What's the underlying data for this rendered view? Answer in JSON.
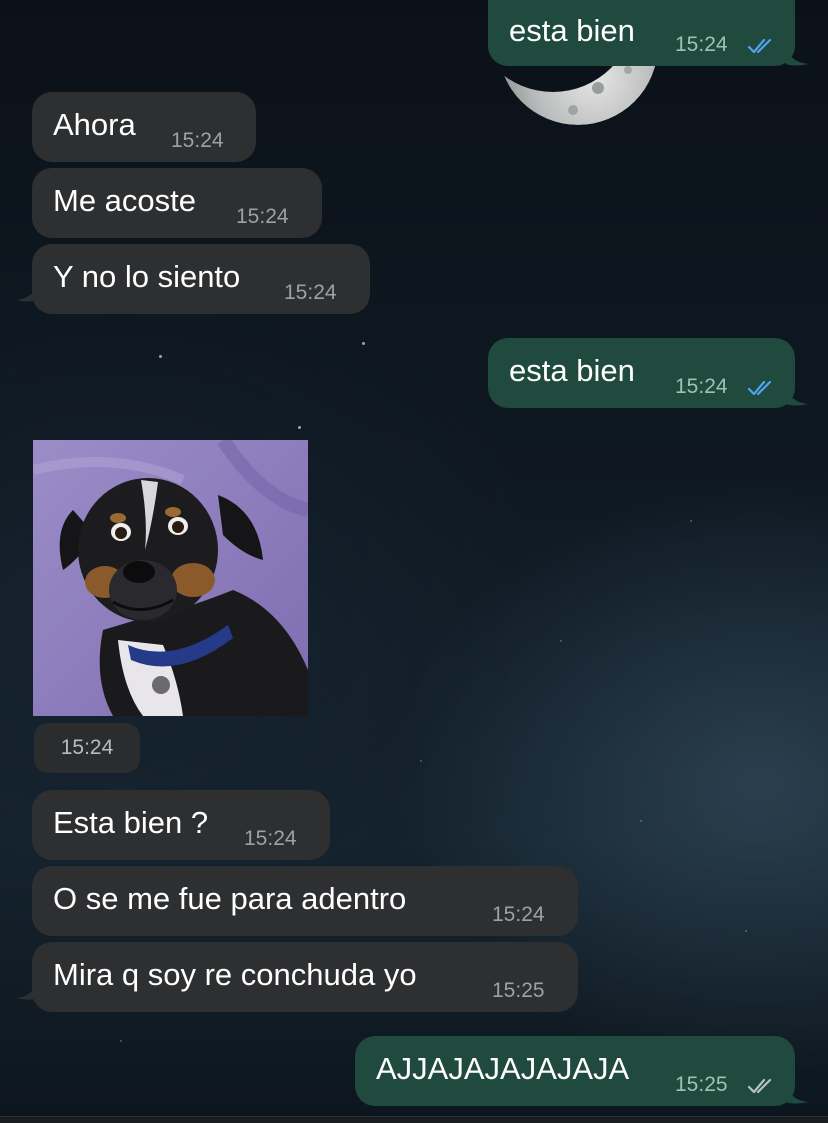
{
  "messages": [
    {
      "id": "m1",
      "direction": "out",
      "text": "esta bien",
      "time": "15:24",
      "status": "read"
    },
    {
      "id": "m2",
      "direction": "in",
      "text": "Ahora",
      "time": "15:24"
    },
    {
      "id": "m3",
      "direction": "in",
      "text": "Me acoste",
      "time": "15:24"
    },
    {
      "id": "m4",
      "direction": "in",
      "text": "Y no lo siento",
      "time": "15:24"
    },
    {
      "id": "m5",
      "direction": "out",
      "text": "esta bien",
      "time": "15:24",
      "status": "read"
    },
    {
      "id": "m6",
      "direction": "in",
      "type": "sticker",
      "subject": "dog-photo",
      "time": "15:24"
    },
    {
      "id": "m7",
      "direction": "in",
      "text": "Esta bien ?",
      "time": "15:24"
    },
    {
      "id": "m8",
      "direction": "in",
      "text": "O se me fue para adentro",
      "time": "15:24"
    },
    {
      "id": "m9",
      "direction": "in",
      "text": "Mira q soy re conchuda yo",
      "time": "15:25"
    },
    {
      "id": "m10",
      "direction": "out",
      "text": "AJJAJAJAJAJAJA",
      "time": "15:25",
      "status": "delivered"
    }
  ],
  "colors": {
    "incoming_bubble": "#2e2f31",
    "outgoing_bubble": "#1f4a3d",
    "read_ticks": "#4fa3f0",
    "delivered_ticks": "#b9c4c0"
  },
  "icons": {
    "read": "double-check-icon",
    "delivered": "double-check-icon",
    "wallpaper": "crescent-moon-icon"
  }
}
